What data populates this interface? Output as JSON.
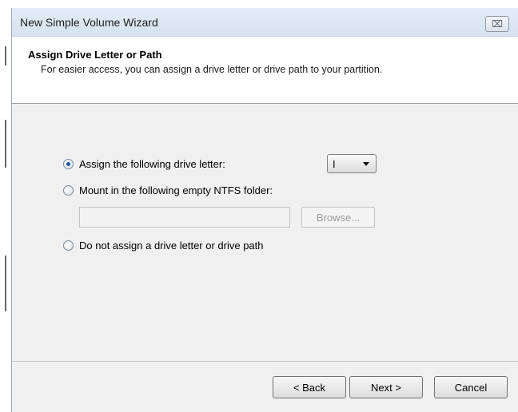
{
  "window": {
    "title": "New Simple Volume Wizard",
    "close_glyph": "⌧"
  },
  "header": {
    "title": "Assign Drive Letter or Path",
    "description": "For easier access, you can assign a drive letter or drive path to your partition."
  },
  "options": {
    "assign_letter": {
      "label": "Assign the following drive letter:",
      "checked": true
    },
    "mount_folder": {
      "label": "Mount in the following empty NTFS folder:",
      "checked": false
    },
    "no_assign": {
      "label": "Do not assign a drive letter or drive path",
      "checked": false
    }
  },
  "drive_letter": {
    "selected": "I"
  },
  "folder_path": {
    "value": ""
  },
  "browse_label": "Browse...",
  "footer": {
    "back_label": "< Back",
    "next_label": "Next >",
    "cancel_label": "Cancel"
  },
  "icons": {
    "close": "close-icon",
    "dropdown": "chevron-down-icon"
  },
  "colors": {
    "titlebar": "#dbe5f1",
    "radio_dot": "#1c56a6",
    "dialog_bg": "#f0f0f0"
  }
}
